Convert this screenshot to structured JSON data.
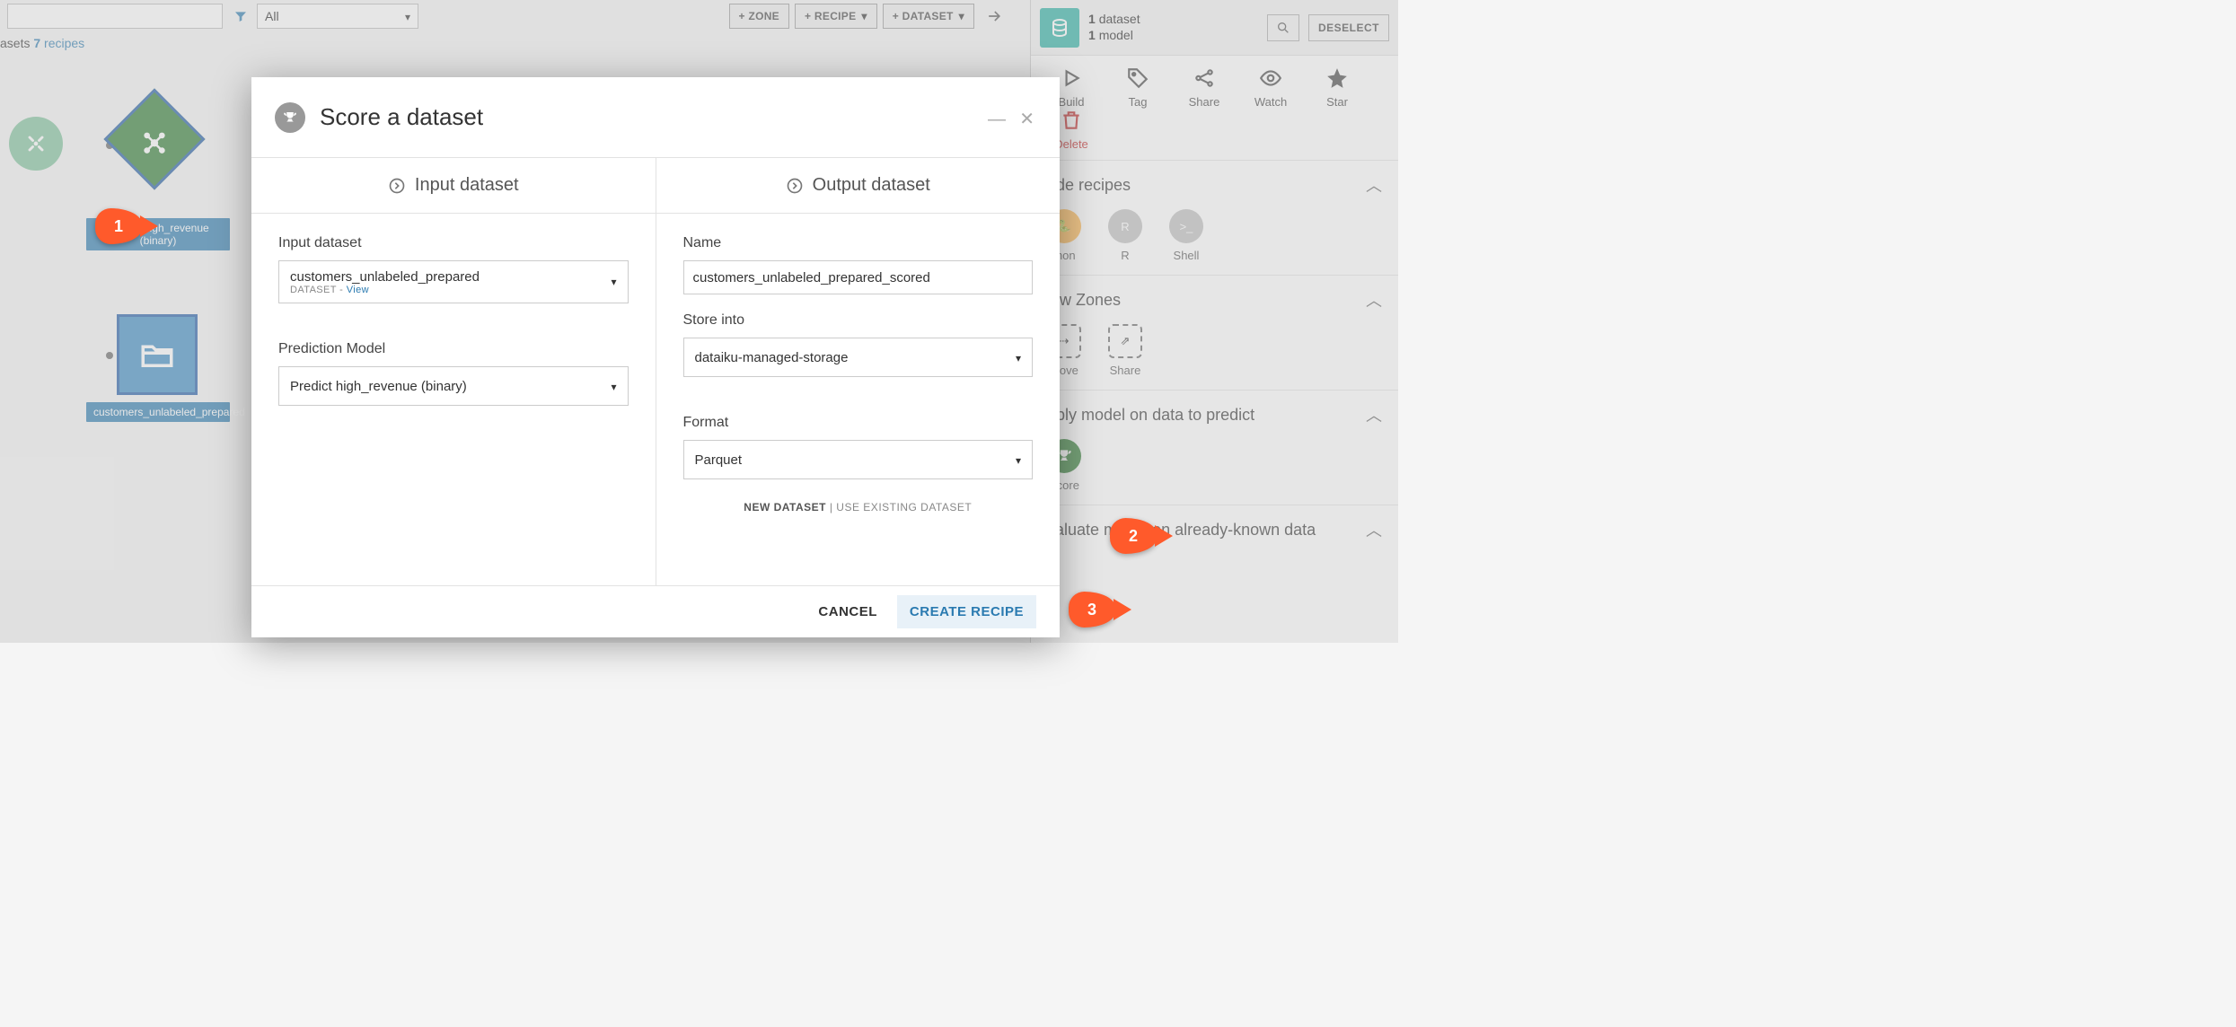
{
  "topbar": {
    "filter_value": "All",
    "buttons": {
      "zone": "+ ZONE",
      "recipe": "+ RECIPE",
      "dataset": "+ DATASET"
    }
  },
  "subbar": {
    "datasets_label": "asets",
    "recipes_count": "7",
    "recipes_label": "recipes"
  },
  "flow": {
    "predict_label": "Predict high_revenue (binary)",
    "folder_label": "customers_unlabeled_prepared"
  },
  "rightpanel": {
    "counts": {
      "datasets_n": "1",
      "datasets_l": "dataset",
      "models_n": "1",
      "models_l": "model"
    },
    "deselect": "DESELECT",
    "actions": {
      "build": "Build",
      "tag": "Tag",
      "share": "Share",
      "watch": "Watch",
      "star": "Star",
      "delete": "Delete"
    },
    "sections": {
      "code": {
        "title": "ode recipes",
        "python": "thon",
        "r": "R",
        "shell": "Shell"
      },
      "zones": {
        "title": "low Zones",
        "move": "Move",
        "share": "Share"
      },
      "predict": {
        "title": "pply model on data to predict",
        "score": "Score"
      },
      "valuate": {
        "title": "valuate model on already-known data"
      }
    }
  },
  "modal": {
    "title": "Score a dataset",
    "input_col": "Input dataset",
    "output_col": "Output dataset",
    "input_dataset_label": "Input dataset",
    "input_dataset_value": "customers_unlabeled_prepared",
    "input_dataset_sub": "DATASET",
    "input_dataset_view": "View",
    "pred_model_label": "Prediction Model",
    "pred_model_value": "Predict high_revenue (binary)",
    "name_label": "Name",
    "name_value": "customers_unlabeled_prepared_scored",
    "store_label": "Store into",
    "store_value": "dataiku-managed-storage",
    "format_label": "Format",
    "format_value": "Parquet",
    "new_dataset": "NEW DATASET",
    "use_existing": "USE EXISTING DATASET",
    "cancel": "CANCEL",
    "create": "CREATE RECIPE"
  },
  "callouts": {
    "c1": "1",
    "c2": "2",
    "c3": "3"
  }
}
